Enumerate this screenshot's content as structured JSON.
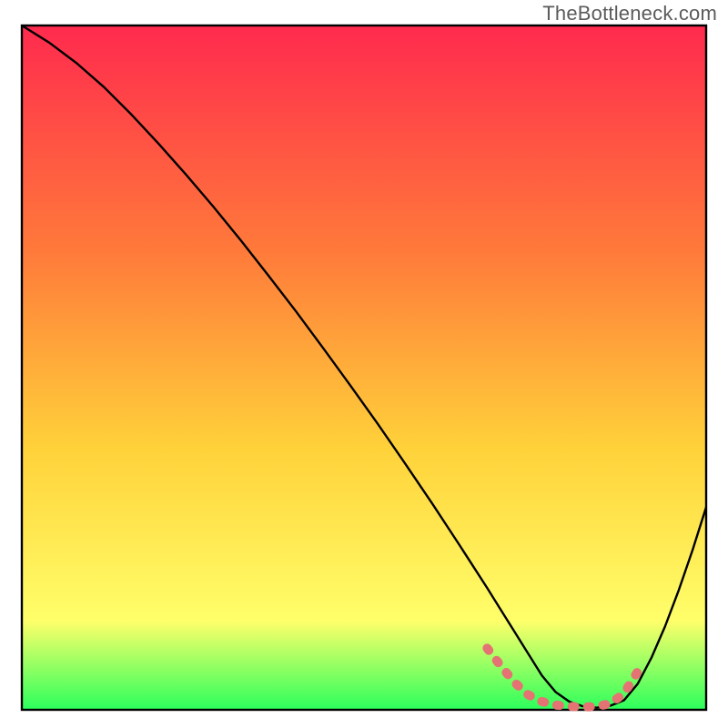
{
  "watermark": "TheBottleneck.com",
  "chart_data": {
    "type": "line",
    "title": "",
    "xlabel": "",
    "ylabel": "",
    "xlim": [
      0,
      100
    ],
    "ylim": [
      0,
      100
    ],
    "background_gradient": {
      "top": "#ff2a4e",
      "mid_upper": "#ff7a3a",
      "mid": "#ffd23a",
      "mid_lower": "#ffff6a",
      "bottom": "#2bff5c"
    },
    "series": [
      {
        "name": "curve",
        "type": "line",
        "color": "#000000",
        "x": [
          0,
          4,
          8,
          12,
          16,
          20,
          24,
          28,
          32,
          36,
          40,
          44,
          48,
          52,
          56,
          60,
          64,
          66,
          68,
          70,
          72,
          74,
          76,
          78,
          80,
          82,
          84,
          86,
          88,
          90,
          92,
          94,
          96,
          98,
          100
        ],
        "y": [
          100,
          97.5,
          94.5,
          91.0,
          87.0,
          82.7,
          78.2,
          73.5,
          68.6,
          63.5,
          58.3,
          52.9,
          47.4,
          41.8,
          36.0,
          30.1,
          24.0,
          20.9,
          17.8,
          14.6,
          11.4,
          8.2,
          5.0,
          2.6,
          1.2,
          0.5,
          0.3,
          0.6,
          1.4,
          3.8,
          7.6,
          12.2,
          17.5,
          23.3,
          29.6
        ]
      },
      {
        "name": "highlight-band",
        "type": "line",
        "color": "#e57373",
        "stroke_width": 10,
        "linecap": "round",
        "x": [
          68,
          70,
          72,
          74,
          76,
          78,
          80,
          82,
          84,
          86,
          88,
          90
        ],
        "y": [
          9.0,
          6.4,
          4.0,
          2.2,
          1.2,
          0.7,
          0.5,
          0.4,
          0.5,
          0.9,
          2.4,
          5.6
        ]
      }
    ]
  }
}
